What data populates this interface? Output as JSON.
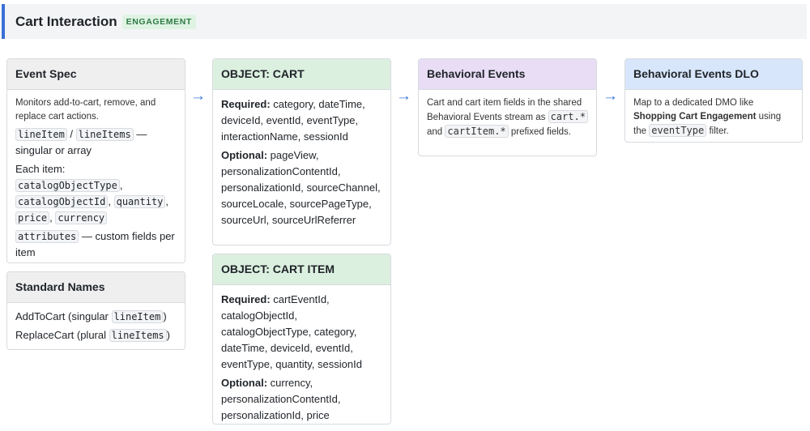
{
  "header": {
    "title": "Cart Interaction",
    "badge": "ENGAGEMENT"
  },
  "event_spec": {
    "title": "Event Spec",
    "description": "Monitors add-to-cart, remove, and replace cart actions.",
    "code_line_item": "lineItem",
    "sep_slash": "/",
    "code_line_items": "lineItems",
    "singular_or_array": "— singular or array",
    "each_item": "Each item:",
    "code_catalog_object_type": "catalogObjectType",
    "code_catalog_object_id": "catalogObjectId",
    "code_quantity": "quantity",
    "code_price": "price",
    "code_currency": "currency",
    "code_attributes": "attributes",
    "custom_fields": "— custom fields per item"
  },
  "standard_names": {
    "title": "Standard Names",
    "add_to_cart": "AddToCart (singular",
    "add_code": "lineItem",
    "close1": ")",
    "replace_cart": "ReplaceCart (plural",
    "replace_code": "lineItems",
    "close2": ")"
  },
  "object_cart": {
    "title": "OBJECT: CART",
    "required_label": "Required:",
    "required_text": "category, dateTime, deviceId, eventId, eventType, interactionName, sessionId",
    "optional_label": "Optional:",
    "optional_text": "pageView, personalizationContentId, personalizationId, sourceChannel, sourceLocale, sourcePageType, sourceUrl, sourceUrlReferrer"
  },
  "object_cart_item": {
    "title": "OBJECT: CART ITEM",
    "required_label": "Required:",
    "required_text": "cartEventId, catalogObjectId, catalogObjectType, category, dateTime, deviceId, eventId, eventType, quantity, sessionId",
    "optional_label": "Optional:",
    "optional_text": "currency, personalizationContentId, personalizationId, price"
  },
  "behavioral_events": {
    "title": "Behavioral Events",
    "text1": "Cart and cart item fields in the shared Behavioral Events stream as",
    "code_cart": "cart.*",
    "and": "and",
    "code_cart_item": "cartItem.*",
    "text2": "prefixed fields."
  },
  "behavioral_events_dlo": {
    "title": "Behavioral Events DLO",
    "text1": "Map to a dedicated DMO like",
    "bold": "Shopping Cart Engagement",
    "text2": "using the",
    "code_event_type": "eventType",
    "text3": "filter."
  },
  "arrow": "→",
  "colors": {
    "accent": "#3b6fd6",
    "arrow": "#3b78d8",
    "green_header": "#dcf0e0",
    "purple_header": "#e8ddf5",
    "blue_header": "#d8e6fb",
    "gray_header": "#efefef"
  }
}
